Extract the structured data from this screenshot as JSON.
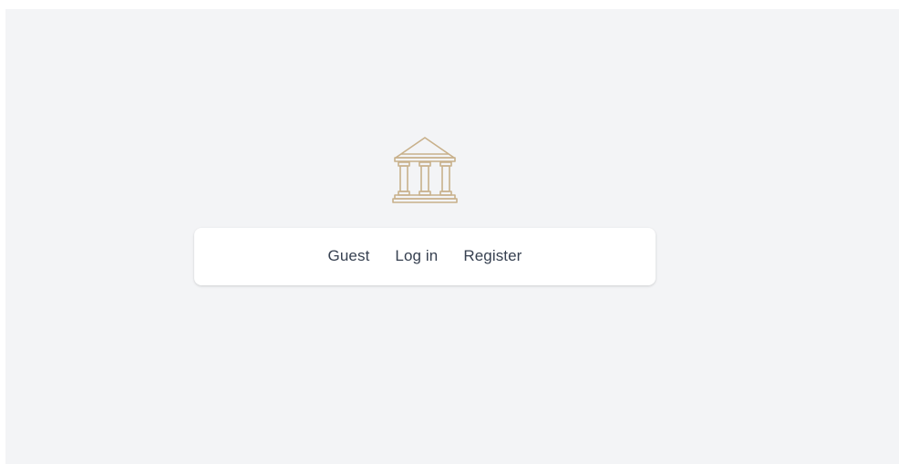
{
  "logo": {
    "icon": "bank-building-icon",
    "color": "#c8b08a"
  },
  "nav": {
    "items": [
      {
        "label": "Guest"
      },
      {
        "label": "Log in"
      },
      {
        "label": "Register"
      }
    ]
  },
  "colors": {
    "background": "#f3f4f6",
    "card": "#ffffff",
    "link_text": "#374151"
  }
}
